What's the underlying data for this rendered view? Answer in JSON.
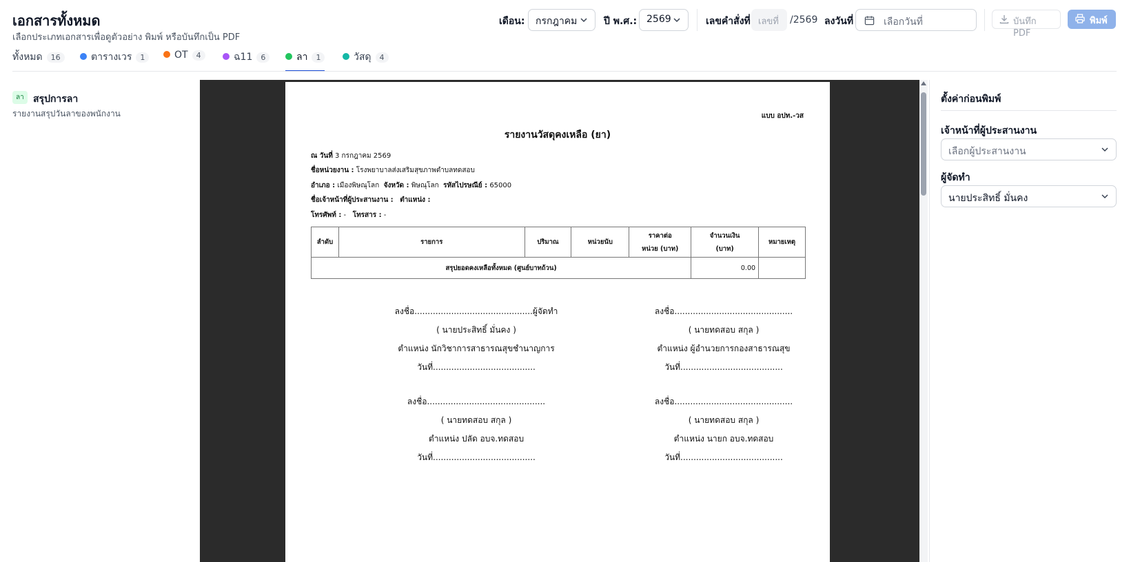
{
  "header": {
    "title": "เอกสารทั้งหมด",
    "subtitle": "เลือกประเภทเอกสารเพื่อดูตัวอย่าง พิมพ์ หรือบันทึกเป็น PDF"
  },
  "toolbar": {
    "month_label": "เดือน:",
    "month_value": "กรกฎาคม",
    "year_label": "ปี พ.ศ.:",
    "year_value": "2569",
    "order_label": "เลขคำสั่งที่",
    "order_placeholder": "เลขที่",
    "order_suffix": "/2569",
    "date_label": "ลงวันที่",
    "date_placeholder": "เลือกวันที่",
    "pdf_label": "บันทึก PDF",
    "print_label": "พิมพ์"
  },
  "tabs": [
    {
      "label": "ทั้งหมด",
      "count": "16",
      "color": ""
    },
    {
      "label": "ตารางเวร",
      "count": "1",
      "color": "#3b82f6"
    },
    {
      "label": "OT",
      "count": "4",
      "color": "#f97316"
    },
    {
      "label": "ฉ11",
      "count": "6",
      "color": "#a855f7"
    },
    {
      "label": "ลา",
      "count": "1",
      "color": "#22c55e"
    },
    {
      "label": "วัสดุ",
      "count": "4",
      "color": "#14b8a6"
    }
  ],
  "active_tab": "ลา",
  "doc_list": [
    {
      "badge": "ลา",
      "title": "สรุปการลา",
      "subtitle": "รายงานสรุปวันลาของพนักงาน"
    }
  ],
  "document": {
    "form_code": "แบบ อปท.-วส",
    "title": "รายงานวัสดุคงเหลือ (ยา)",
    "date_label": "ณ วันที่",
    "date_value": "3 กรกฎาคม 2569",
    "unit_label": "ชื่อหน่วยงาน :",
    "unit_value": "โรงพยาบาลส่งเสริมสุขภาพตำบลทดสอบ",
    "district_label": "อำเภอ :",
    "district_value": "เมืองพิษณุโลก",
    "province_label": "จังหวัด :",
    "province_value": "พิษณุโลก",
    "postal_label": "รหัสไปรษณีย์ :",
    "postal_value": "65000",
    "coordinator_label": "ชื่อเจ้าหน้าที่ผู้ประสานงาน :",
    "position_label": "ตำแหน่ง :",
    "phone_label": "โทรศัพท์ :",
    "phone_value": "-",
    "fax_label": "โทรสาร :",
    "fax_value": "-",
    "table": {
      "headers": [
        "ลำดับ",
        "รายการ",
        "ปริมาณ",
        "หน่วยนับ",
        "ราคาต่อ",
        "หน่วย (บาท)",
        "จำนวนเงิน",
        "(บาท)",
        "หมายเหตุ"
      ],
      "summary_label": "สรุปยอดคงเหลือทั้งหมด (ศูนย์บาทถ้วน)",
      "summary_amount": "0.00"
    },
    "signatures": [
      {
        "sign": "ลงชื่อ.............................................ผู้จัดทำ",
        "name": "( นายประสิทธิ์ มั่นคง )",
        "position": "ตำแหน่ง นักวิชาการสาธารณสุขชำนาญการ",
        "date": "วันที่......................................."
      },
      {
        "sign": "ลงชื่อ.............................................",
        "name": "( นายทดสอบ สกุล )",
        "position": "ตำแหน่ง ผู้อำนวยการกองสาธารณสุข",
        "date": "วันที่......................................."
      },
      {
        "sign": "ลงชื่อ.............................................",
        "name": "( นายทดสอบ สกุล )",
        "position": "ตำแหน่ง ปลัด อบจ.ทดสอบ",
        "date": "วันที่......................................."
      },
      {
        "sign": "ลงชื่อ.............................................",
        "name": "( นายทดสอบ สกุล )",
        "position": "ตำแหน่ง นายก อบจ.ทดสอบ",
        "date": "วันที่......................................."
      }
    ]
  },
  "settings": {
    "title": "ตั้งค่าก่อนพิมพ์",
    "coordinator_label": "เจ้าหน้าที่ผู้ประสานงาน",
    "coordinator_placeholder": "เลือกผู้ประสานงาน",
    "preparer_label": "ผู้จัดทำ",
    "preparer_value": "นายประสิทธิ์ มั่นคง"
  }
}
